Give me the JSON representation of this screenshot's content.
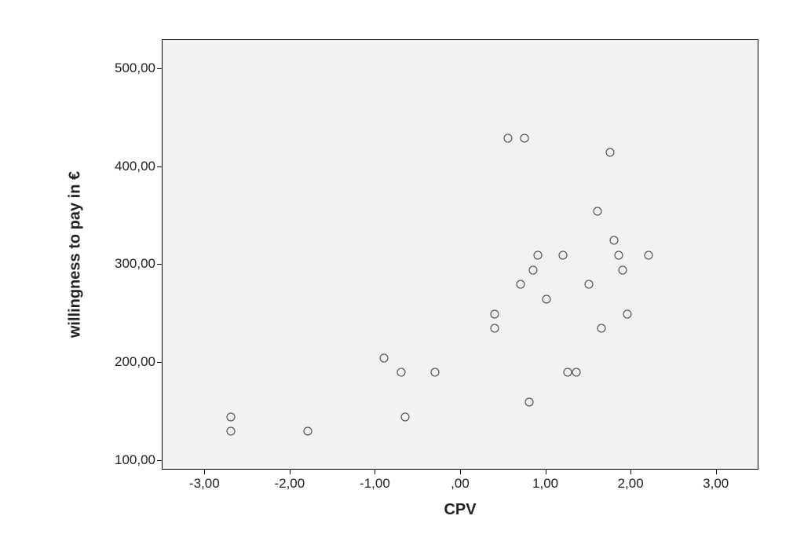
{
  "chart_data": {
    "type": "scatter",
    "xlabel": "CPV",
    "ylabel": "willingness to pay in €",
    "xlim": [
      -3.5,
      3.5
    ],
    "ylim": [
      90,
      530
    ],
    "x_ticks": [
      -3.0,
      -2.0,
      -1.0,
      0.0,
      1.0,
      2.0,
      3.0
    ],
    "x_tick_labels": [
      "-3,00",
      "-2,00",
      "-1,00",
      ",00",
      "1,00",
      "2,00",
      "3,00"
    ],
    "y_ticks": [
      100,
      200,
      300,
      400,
      500
    ],
    "y_tick_labels": [
      "100,00",
      "200,00",
      "300,00",
      "400,00",
      "500,00"
    ],
    "points": [
      {
        "x": -2.7,
        "y": 145
      },
      {
        "x": -2.7,
        "y": 130
      },
      {
        "x": -1.8,
        "y": 130
      },
      {
        "x": -0.9,
        "y": 205
      },
      {
        "x": -0.7,
        "y": 190
      },
      {
        "x": -0.65,
        "y": 145
      },
      {
        "x": -0.3,
        "y": 190
      },
      {
        "x": 0.4,
        "y": 250
      },
      {
        "x": 0.4,
        "y": 235
      },
      {
        "x": 0.55,
        "y": 430
      },
      {
        "x": 0.7,
        "y": 280
      },
      {
        "x": 0.75,
        "y": 430
      },
      {
        "x": 0.8,
        "y": 160
      },
      {
        "x": 0.85,
        "y": 295
      },
      {
        "x": 0.9,
        "y": 310
      },
      {
        "x": 1.0,
        "y": 265
      },
      {
        "x": 1.2,
        "y": 310
      },
      {
        "x": 1.25,
        "y": 190
      },
      {
        "x": 1.35,
        "y": 190
      },
      {
        "x": 1.5,
        "y": 280
      },
      {
        "x": 1.6,
        "y": 355
      },
      {
        "x": 1.65,
        "y": 235
      },
      {
        "x": 1.75,
        "y": 415
      },
      {
        "x": 1.8,
        "y": 325
      },
      {
        "x": 1.85,
        "y": 310
      },
      {
        "x": 1.9,
        "y": 295
      },
      {
        "x": 1.95,
        "y": 250
      },
      {
        "x": 2.2,
        "y": 310
      }
    ]
  }
}
